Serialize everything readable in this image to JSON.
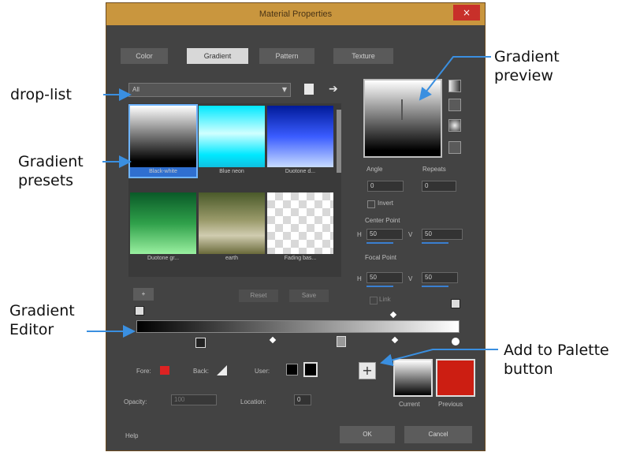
{
  "annotations": {
    "drop_list": "drop-list",
    "gradient_presets": "Gradient\npresets",
    "gradient_editor": "Gradient\nEditor",
    "gradient_preview": "Gradient\npreview",
    "add_to_palette": "Add to Palette\nbutton"
  },
  "dialog": {
    "title": "Material Properties",
    "close_glyph": "×",
    "tabs": [
      {
        "label": "Color"
      },
      {
        "label": "Gradient"
      },
      {
        "label": "Pattern"
      },
      {
        "label": "Texture"
      }
    ],
    "category_value": "All",
    "presets": [
      {
        "label": "Black-white"
      },
      {
        "label": "Blue neon"
      },
      {
        "label": "Duotone d..."
      },
      {
        "label": "Duotone gr..."
      },
      {
        "label": "earth"
      },
      {
        "label": "Fading bas..."
      }
    ],
    "angle_label": "Angle",
    "repeats_label": "Repeats",
    "angle_value": "0",
    "repeats_value": "0",
    "invert_label": "Invert",
    "center_point_label": "Center Point",
    "focal_point_label": "Focal Point",
    "h_label": "H",
    "v_label": "V",
    "center_h": "50",
    "center_v": "50",
    "focal_h": "50",
    "focal_v": "50",
    "link_label": "Link",
    "reset_label": "Reset",
    "save_label": "Save",
    "fore_label": "Fore:",
    "back_label": "Back:",
    "user_label": "User:",
    "opacity_label": "Opacity:",
    "opacity_value": "100",
    "location_label": "Location:",
    "location_value": "0",
    "current_label": "Current",
    "previous_label": "Previous",
    "help_label": "Help",
    "ok_label": "OK",
    "cancel_label": "Cancel",
    "plus_glyph": "+"
  },
  "colors": {
    "dialog_bg": "#434343",
    "title_bar": "#c9963e",
    "callout_arrow": "#3a8fe0",
    "previous_color": "#cc1e12"
  },
  "icons": [
    "close-icon",
    "dropdown-arrow-icon",
    "save-preset-icon",
    "more-options-icon",
    "linear-gradient-icon",
    "rectangular-gradient-icon",
    "radial-gradient-icon",
    "sunburst-gradient-icon",
    "add-to-palette-icon",
    "arrow-icon"
  ]
}
